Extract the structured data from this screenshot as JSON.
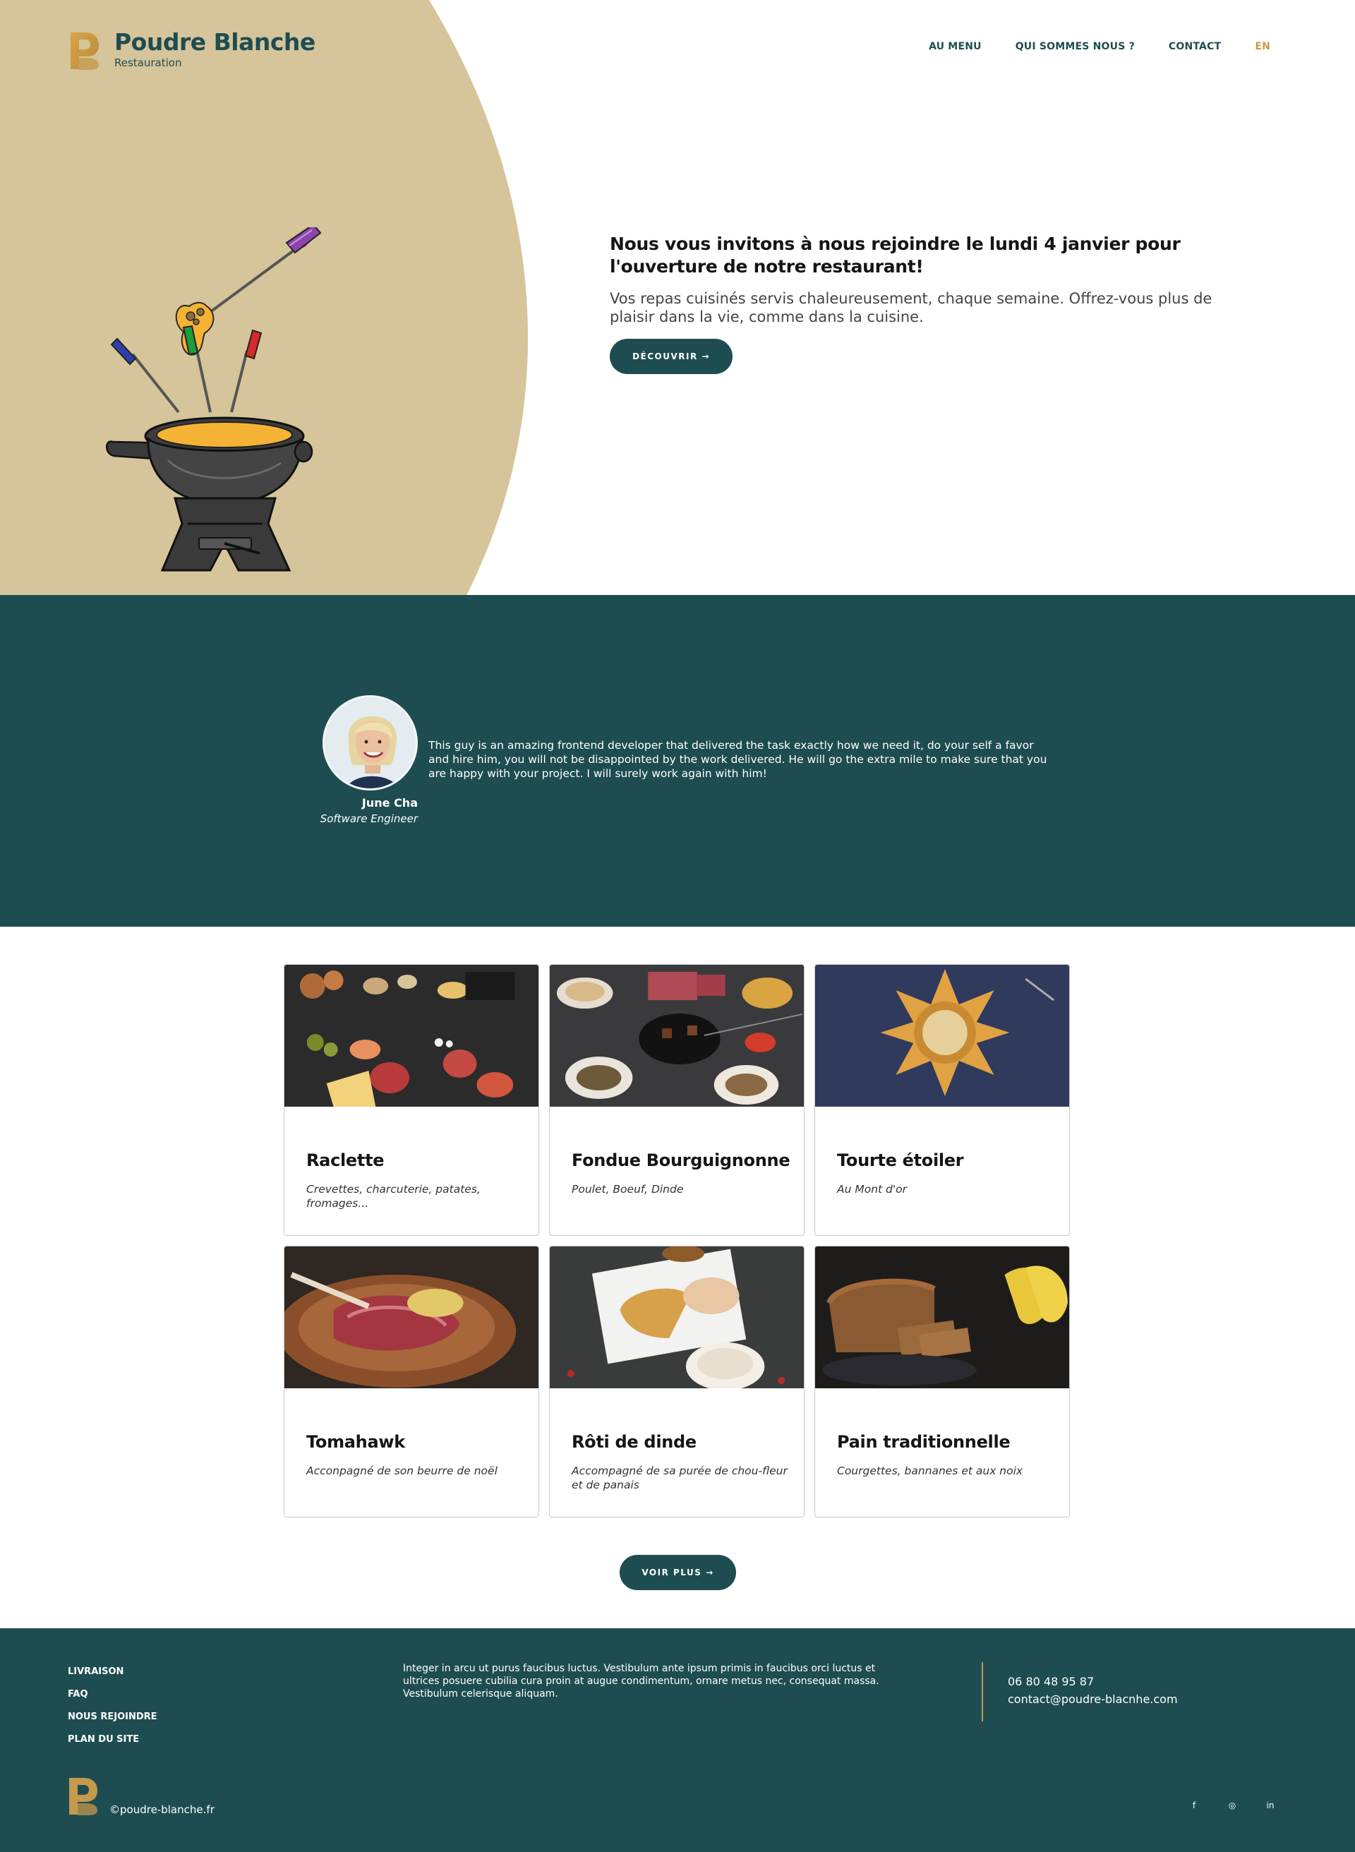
{
  "brand": {
    "name": "Poudre Blanche",
    "tagline": "Restauration",
    "color_primary": "#1e4d51",
    "color_accent": "#c49a4c",
    "color_sand": "#d6c49a"
  },
  "nav": {
    "items": [
      "AU MENU",
      "QUI SOMMES NOUS ?",
      "CONTACT"
    ],
    "language": "EN"
  },
  "hero": {
    "title": "Nous vous invitons à nous rejoindre le lundi 4 janvier pour l'ouverture de notre restaurant!",
    "description": "Vos repas cuisinés servis chaleureusement, chaque semaine. Offrez-vous plus de plaisir dans la vie, comme dans la cuisine.",
    "button_label": "DÉCOUVRIR →",
    "illustration": "fondue-pot-illustration"
  },
  "testimonial": {
    "quote": "This guy is an amazing frontend developer that delivered the task exactly how we need it, do your self a favor and hire him, you will not be disappointed by the work delivered. He will go the extra mile to make sure that you are happy with your project. I will surely work again with him!",
    "name": "June Cha",
    "role": "Software Engineer"
  },
  "dishes": [
    {
      "title": "Raclette",
      "description": "Crevettes, charcuterie, patates, fromages..."
    },
    {
      "title": "Fondue Bourguignonne",
      "description": "Poulet, Boeuf, Dinde"
    },
    {
      "title": "Tourte étoiler",
      "description": "Au Mont d'or"
    },
    {
      "title": "Tomahawk",
      "description": "Acconpagné de son beurre de noël"
    },
    {
      "title": "Rôti de dinde",
      "description": "Accompagné de sa purée de chou-fleur et de panais"
    },
    {
      "title": "Pain traditionnelle",
      "description": "Courgettes, bannanes et aux noix"
    }
  ],
  "more_button": "VOIR PLUS →",
  "footer": {
    "links": [
      "LIVRAISON",
      "FAQ",
      "NOUS REJOINDRE",
      "PLAN DU SITE"
    ],
    "text": "Integer in arcu ut purus faucibus luctus. Vestibulum ante ipsum primis in faucibus orci luctus et ultrices posuere cubilia cura proin at augue condimentum, ornare metus nec, consequat massa. Vestibulum celerisque aliquam.",
    "phone": "06 80 48 95 87",
    "email": "contact@poudre-blacnhe.com",
    "copyright": "©poudre-blanche.fr",
    "social": [
      {
        "icon": "facebook-icon",
        "glyph": "f"
      },
      {
        "icon": "instagram-icon",
        "glyph": "◎"
      },
      {
        "icon": "linkedin-icon",
        "glyph": "in"
      }
    ]
  }
}
